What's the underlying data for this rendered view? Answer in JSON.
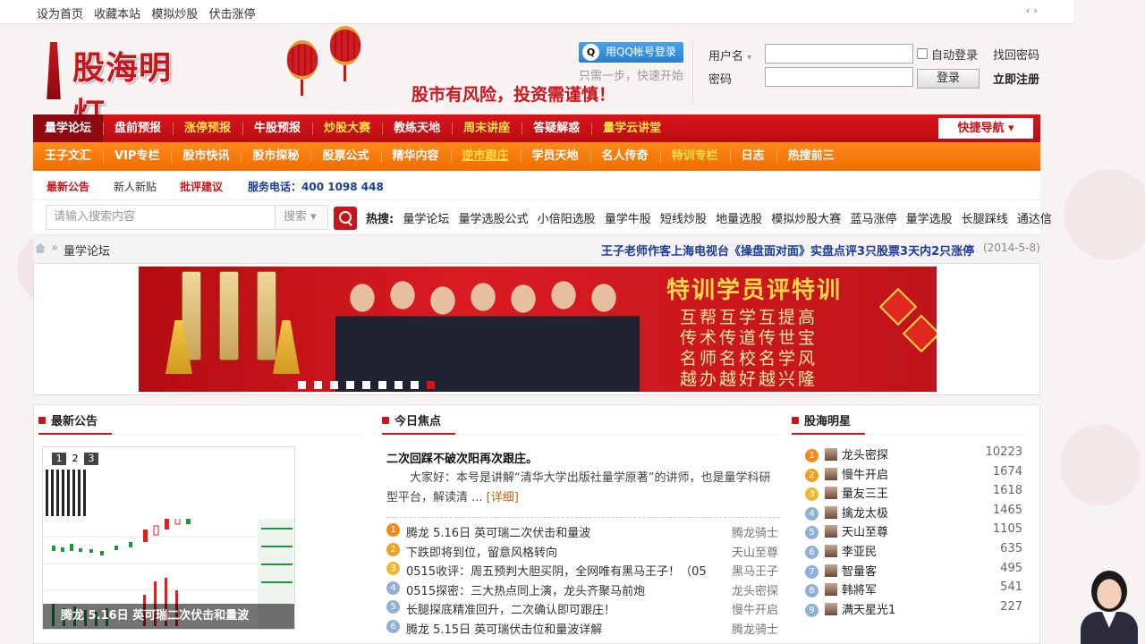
{
  "topbar": {
    "links": [
      "设为首页",
      "收藏本站",
      "模拟炒股",
      "伏击涨停"
    ],
    "arrows": "‹ ›"
  },
  "header": {
    "logo_text": "股海明灯",
    "slogan": "股市有风险，投资需谨慎！",
    "qq_login": "用QQ帐号登录",
    "qq_sub": "只需一步，快速开始",
    "username_label": "用户名",
    "password_label": "密码",
    "auto_login": "自动登录",
    "find_password": "找回密码",
    "login_button": "登录",
    "register": "立即注册"
  },
  "nav1": {
    "items": [
      {
        "label": "量学论坛",
        "style": "active"
      },
      {
        "label": "盘前预报",
        "style": "white"
      },
      {
        "label": "涨停预报",
        "style": "yellow"
      },
      {
        "label": "牛股预报",
        "style": "white"
      },
      {
        "label": "炒股大赛",
        "style": "yellow"
      },
      {
        "label": "教练天地",
        "style": "white"
      },
      {
        "label": "周末讲座",
        "style": "yellow"
      },
      {
        "label": "答疑解惑",
        "style": "white"
      },
      {
        "label": "量学云讲堂",
        "style": "yellow"
      }
    ],
    "quick_nav": "快捷导航 ▾"
  },
  "nav2": {
    "items": [
      {
        "label": "王子文汇",
        "style": "white"
      },
      {
        "label": "VIP专栏",
        "style": "white"
      },
      {
        "label": "股市快讯",
        "style": "white"
      },
      {
        "label": "股市探秘",
        "style": "white"
      },
      {
        "label": "股票公式",
        "style": "white"
      },
      {
        "label": "精华内容",
        "style": "white"
      },
      {
        "label": "逆市跟庄",
        "style": "underline"
      },
      {
        "label": "学员天地",
        "style": "white"
      },
      {
        "label": "名人传奇",
        "style": "white"
      },
      {
        "label": "特训专栏",
        "style": "yellow"
      },
      {
        "label": "日志",
        "style": "white"
      },
      {
        "label": "热搜前三",
        "style": "white"
      }
    ]
  },
  "subnav": {
    "latest_notice": "最新公告",
    "newbie": "新人新贴",
    "feedback": "批评建议",
    "phone": "服务电话：400 1098 448"
  },
  "search": {
    "placeholder": "请输入搜索内容",
    "select": "搜索 ▾",
    "hot_label": "热搜:",
    "hot_items": [
      "量学论坛",
      "量学选股公式",
      "小倍阳选股",
      "量学牛股",
      "短线炒股",
      "地量选股",
      "模拟炒股大赛",
      "蓝马涨停",
      "量学选股",
      "长腿踩线",
      "通达信"
    ]
  },
  "breadcrumb": {
    "sep": "»",
    "current": "量学论坛",
    "news": "王子老师作客上海电视台《操盘面对面》实盘点评3只股票3天内2只涨停",
    "date": "(2014-5-8)"
  },
  "banner": {
    "title": "特训学员评特训",
    "poem": [
      "互帮互学互提高",
      "传术传道传世宝",
      "名师名校名学风",
      "越办越好越兴隆"
    ],
    "dots": 9,
    "active_dot": 9
  },
  "sections": {
    "notice": "最新公告",
    "focus": "今日焦点",
    "stars": "股海明星"
  },
  "notice_slide": {
    "pages": [
      "1",
      "2",
      "3"
    ],
    "active_page": "2",
    "caption": "腾龙 5.16日 英可瑞二次伏击和量波"
  },
  "focus": {
    "headline": "二次回踩不破次阳再次跟庄。",
    "body": "大家好：本号是讲解“清华大学出版社量学原著”的讲师，也是量学科研型平台，解读清 ...",
    "more": "[详细]",
    "list": [
      {
        "num": "1",
        "title": "腾龙 5.16日 英可瑞二次伏击和量波",
        "author": "腾龙骑士",
        "color": "#f08a1a"
      },
      {
        "num": "2",
        "title": "下跌即将到位，留意风格转向",
        "author": "天山至尊",
        "color": "#f0a020"
      },
      {
        "num": "3",
        "title": "0515收评：周五预判大胆买阴，全网唯有黑马王子！（05",
        "author": "黑马王子",
        "color": "#f0b830"
      },
      {
        "num": "4",
        "title": "0515探密：三大热点同上演，龙头齐聚马前炮",
        "author": "龙头密探",
        "color": "#8fb0d8"
      },
      {
        "num": "5",
        "title": "长腿探底精准回升，二次确认即可跟庄！",
        "author": "慢牛开启",
        "color": "#8fb0d8"
      },
      {
        "num": "6",
        "title": "腾龙 5.15日 英可瑞伏击位和量波详解",
        "author": "腾龙骑士",
        "color": "#8fb0d8"
      }
    ]
  },
  "stars": [
    {
      "num": "1",
      "name": "龙头密探",
      "count": "10223",
      "color": "#f08a1a"
    },
    {
      "num": "2",
      "name": "慢牛开启",
      "count": "1674",
      "color": "#f0a020"
    },
    {
      "num": "3",
      "name": "量友三王",
      "count": "1618",
      "color": "#f0b830"
    },
    {
      "num": "4",
      "name": "擒龙太极",
      "count": "1465",
      "color": "#8fb0d8"
    },
    {
      "num": "5",
      "name": "天山至尊",
      "count": "1105",
      "color": "#8fb0d8"
    },
    {
      "num": "6",
      "name": "李亚民",
      "count": "635",
      "color": "#8fb0d8"
    },
    {
      "num": "7",
      "name": "智量客",
      "count": "495",
      "color": "#8fb0d8"
    },
    {
      "num": "8",
      "name": "韩將军",
      "count": "541",
      "color": "#8fb0d8"
    },
    {
      "num": "9",
      "name": "满天星光1",
      "count": "227",
      "color": "#8fb0d8"
    }
  ],
  "colors": {
    "brand_red": "#c8141b",
    "nav_orange": "#f06c00",
    "accent_yellow": "#ffe14a",
    "link_blue": "#1a3c9a"
  }
}
